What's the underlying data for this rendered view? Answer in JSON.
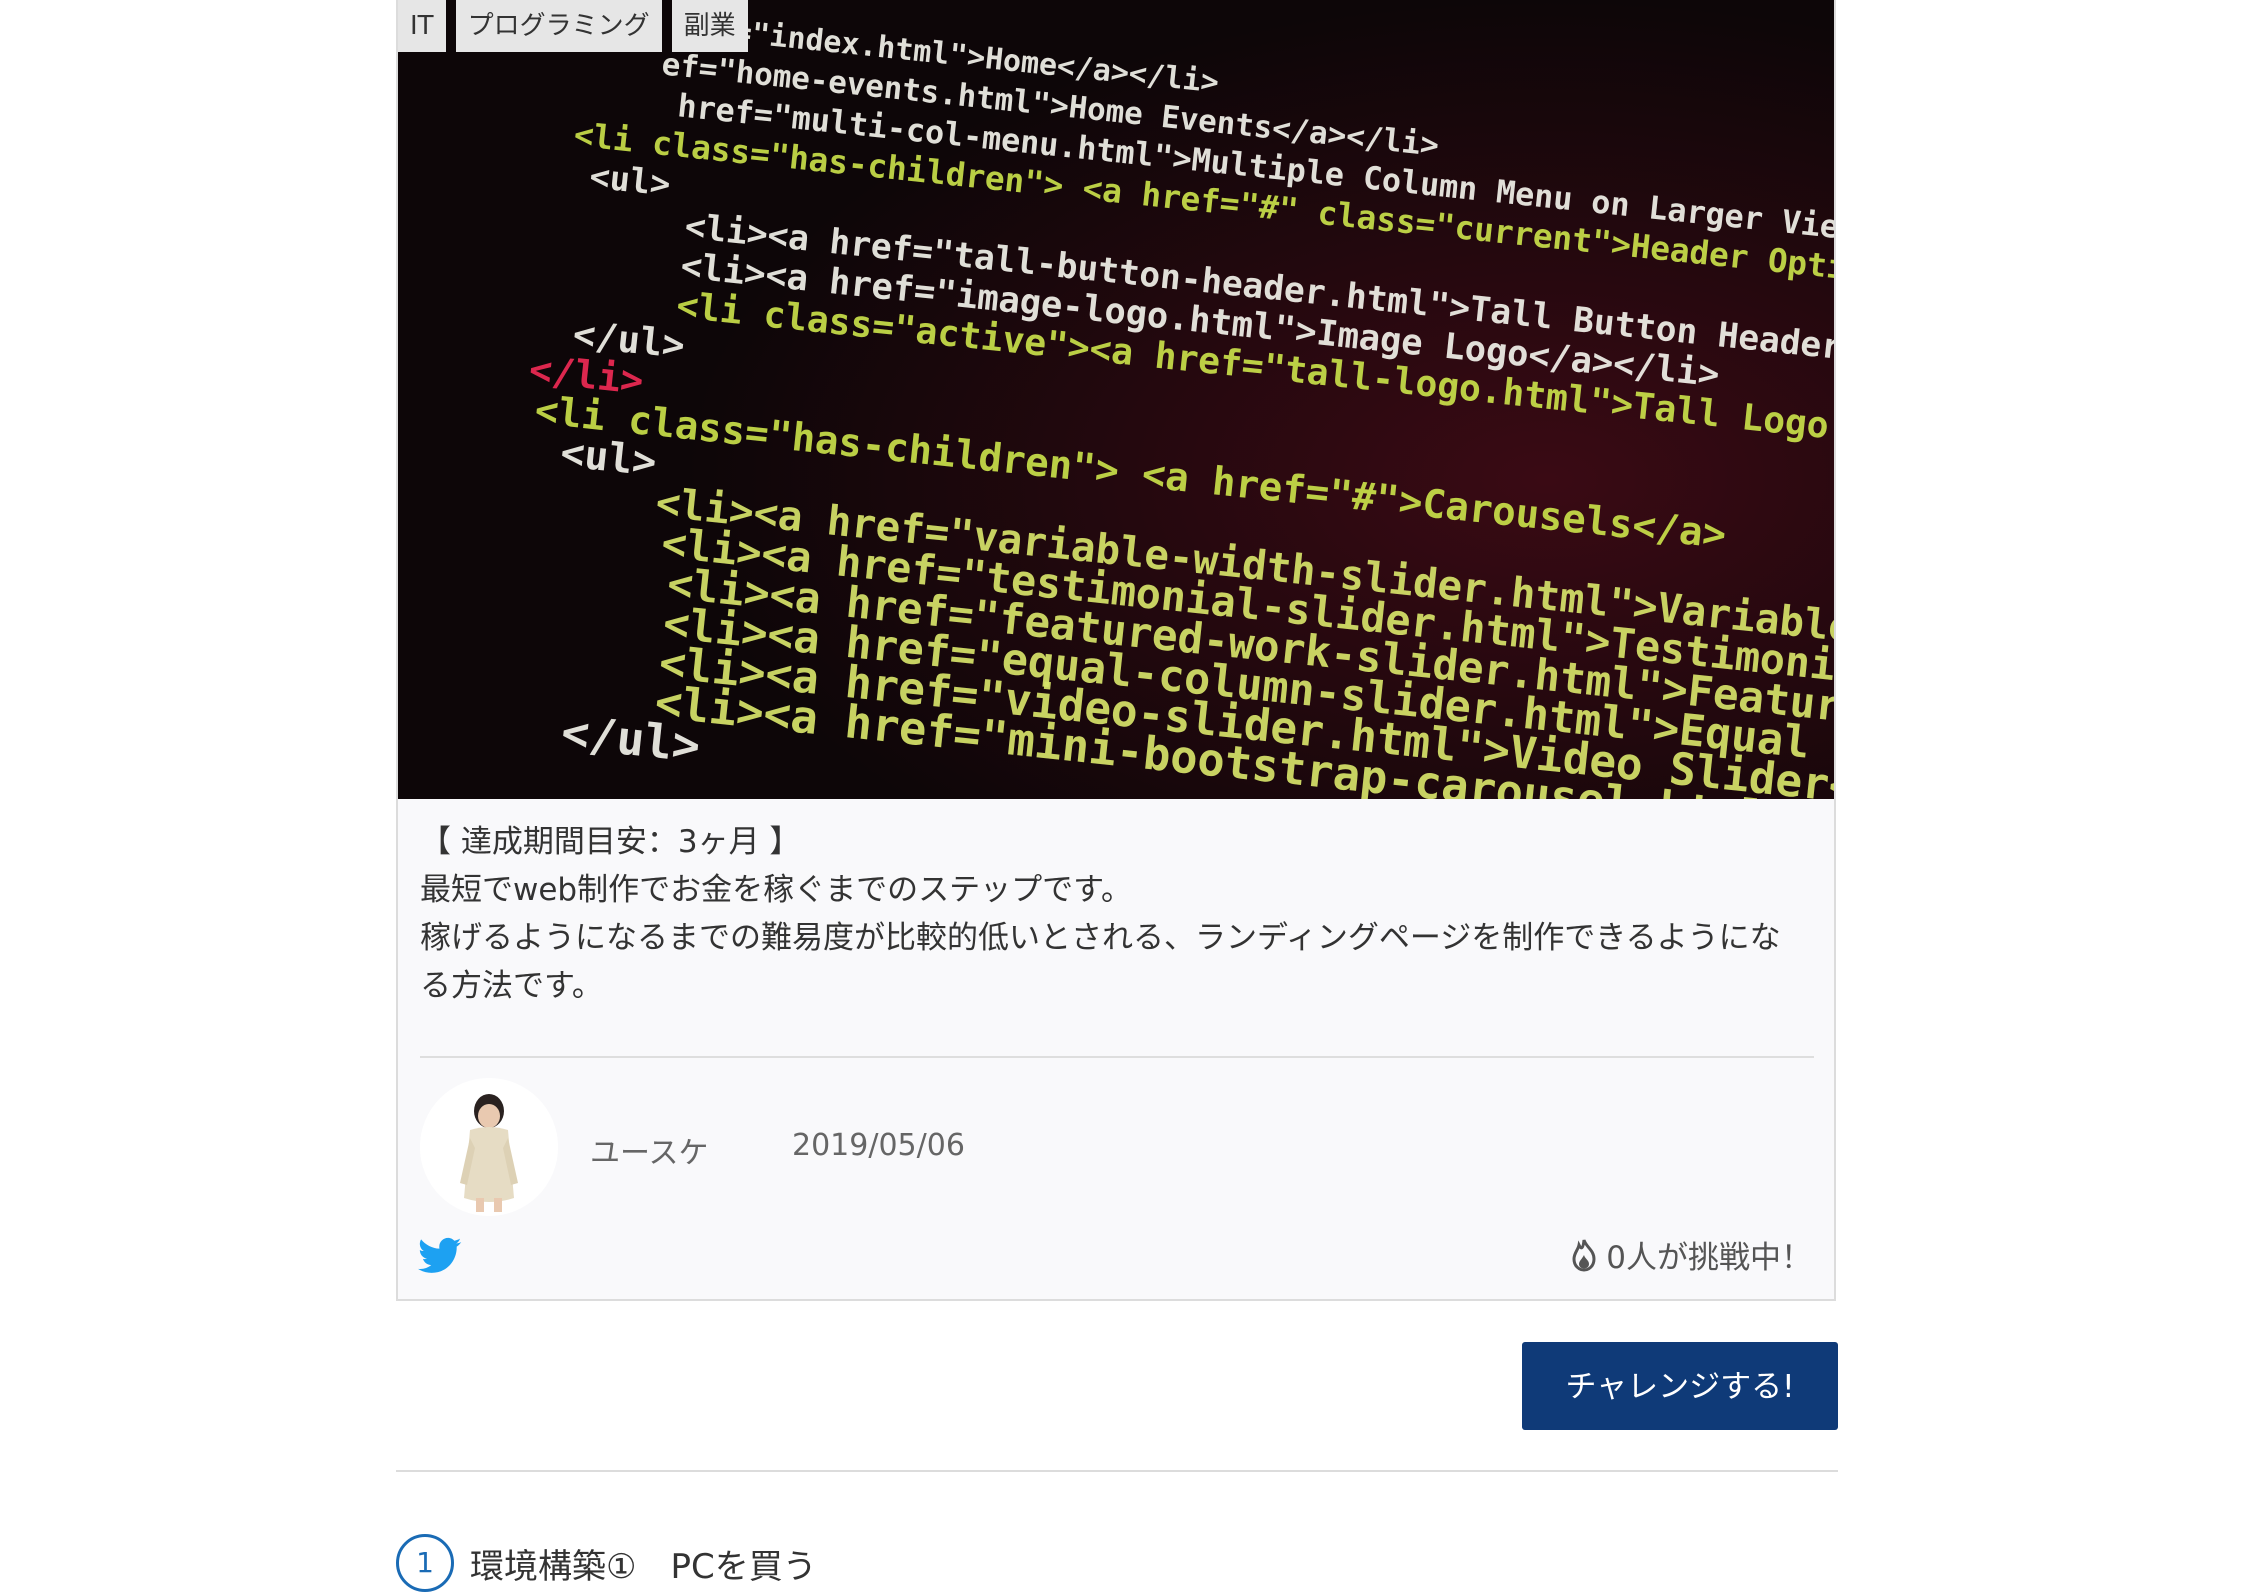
{
  "tags": [
    "IT",
    "プログラミング",
    "副業"
  ],
  "hero": {
    "code_lines": [
      "f=\"index.html\">Home</a></li>",
      "ef=\"home-events.html\">Home Events</a></li>",
      "href=\"multi-col-menu.html\">Multiple Column Menu on Larger Viewports",
      "<li class=\"has-children\"> <a href=\"#\" class=\"current\">Header Options</a>",
      "<ul>",
      "<li><a href=\"tall-button-header.html\">Tall Button Header</a></li>",
      "<li><a href=\"image-logo.html\">Image Logo</a></li>",
      "<li class=\"active\"><a href=\"tall-logo.html\">Tall Logo Image</a>",
      "</ul>",
      "</li>",
      "<li class=\"has-children\"> <a href=\"#\">Carousels</a>",
      "<ul>",
      "<li><a href=\"variable-width-slider.html\">Variable Image Width",
      "<li><a href=\"testimonial-slider.html\">Testimonial Slider</a>",
      "<li><a href=\"featured-work-slider.html\">Featured Work Slider",
      "<li><a href=\"equal-column-slider.html\">Equal Column Slider",
      "<li><a href=\"video-slider.html\">Video Slider</a></li>",
      "<li><a href=\"mini-bootstrap-carousel.html\">Mini Slider</a>",
      "</ul>"
    ]
  },
  "description": {
    "line1": "【 達成期間目安：3ヶ月 】",
    "line2": "最短でweb制作でお金を稼ぐまでのステップです。",
    "line3": "稼げるようになるまでの難易度が比較的低いとされる、ランディングページを制作できるようになる方法です。"
  },
  "author": {
    "name": "ユースケ",
    "date": "2019/05/06"
  },
  "challengers": "0人が挑戦中！",
  "cta_label": "チャレンジする!",
  "step": {
    "number": "1",
    "title": "環境構築①　PCを買う"
  },
  "colors": {
    "cta_bg": "#0f3a78",
    "twitter": "#1da1f2",
    "step_accent": "#1a6bb5"
  }
}
